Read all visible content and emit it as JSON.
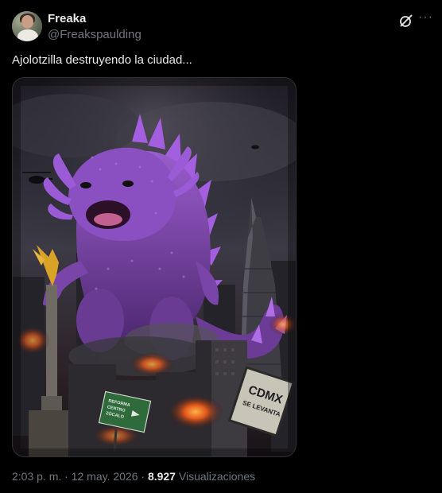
{
  "tweet": {
    "author_name": "Freaka",
    "author_handle": "@Freakspaulding",
    "text": "Ajolotzilla destruyendo la ciudad...",
    "timestamp": "2:03 p. m. · 12 may. 2026 · ",
    "views_count": "8.927",
    "views_label": " Visualizaciones"
  },
  "image": {
    "sign_cdmx_line1": "CDMX",
    "sign_cdmx_line2": "SE LEVANTA",
    "road_sign_line1": "REFORMA",
    "road_sign_line2": "CENTRO",
    "road_sign_line3": "ZÓCALO"
  },
  "icons": {
    "grok": "grok-icon",
    "more": "more-icon"
  },
  "colors": {
    "background": "#000000",
    "text_primary": "#e7e9ea",
    "text_secondary": "#71767b",
    "border": "#2f3336",
    "monster": "#8a4fc0"
  }
}
